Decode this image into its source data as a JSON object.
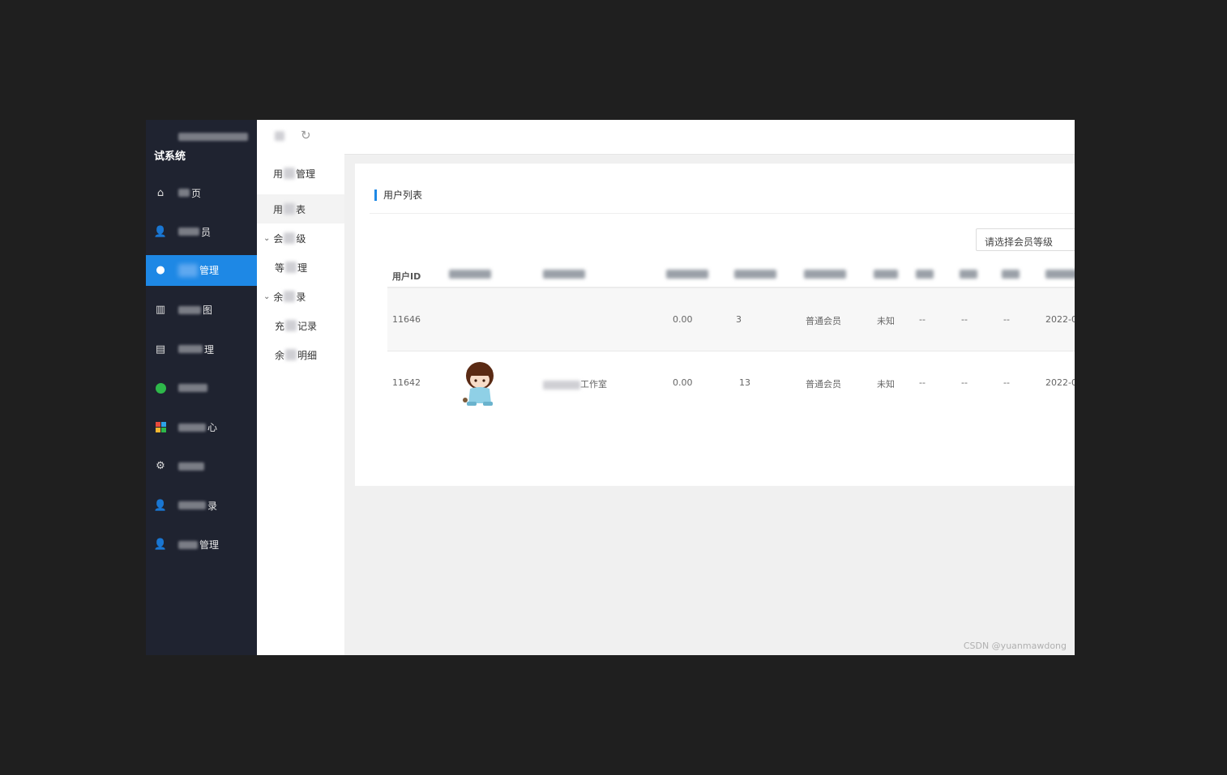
{
  "sidebar": {
    "logo_text": "试系统",
    "items": [
      {
        "icon": "home-icon",
        "label": "页",
        "active": false
      },
      {
        "icon": "user-settings-icon",
        "label": "员",
        "active": false
      },
      {
        "icon": "user-icon",
        "label": "管理",
        "active": true
      },
      {
        "icon": "library-icon",
        "label": "图",
        "active": false
      },
      {
        "icon": "document-icon",
        "label": "理",
        "active": false
      },
      {
        "icon": "music-icon",
        "label": "",
        "active": false
      },
      {
        "icon": "apps-icon",
        "label": "心",
        "active": false
      },
      {
        "icon": "gear-icon",
        "label": "",
        "active": false
      },
      {
        "icon": "user-settings-icon",
        "label": "录",
        "active": false
      },
      {
        "icon": "user-settings-icon",
        "label": "管理",
        "active": false
      }
    ]
  },
  "subnav": {
    "items": [
      {
        "type": "header",
        "pre": "用",
        "post": "管理"
      },
      {
        "type": "item",
        "pre": "用",
        "post": "表",
        "active": true
      },
      {
        "type": "group",
        "pre": "会",
        "post": "级"
      },
      {
        "type": "child",
        "pre": "等",
        "post": "理"
      },
      {
        "type": "group",
        "pre": "余",
        "post": "录"
      },
      {
        "type": "child",
        "pre": "充",
        "post": "记录"
      },
      {
        "type": "child",
        "pre": "余",
        "post": "明细"
      }
    ]
  },
  "header": {
    "refresh_icon": "refresh-icon"
  },
  "card": {
    "title": "用户列表",
    "select_placeholder": "请选择会员等级"
  },
  "table": {
    "headers": [
      "用户ID",
      "",
      "",
      "",
      "",
      "",
      "",
      "",
      "",
      "",
      ""
    ],
    "rows": [
      {
        "id": "11646",
        "name": "",
        "balance": "0.00",
        "count": "3",
        "level": "普通会员",
        "gender": "未知",
        "c1": "--",
        "c2": "--",
        "c3": "--",
        "date": "2022-0",
        "has_avatar": false
      },
      {
        "id": "11642",
        "name": "工作室",
        "balance": "0.00",
        "count": "13",
        "level": "普通会员",
        "gender": "未知",
        "c1": "--",
        "c2": "--",
        "c3": "--",
        "date": "2022-0",
        "has_avatar": true
      }
    ]
  },
  "watermark": "CSDN @yuanmawdong",
  "colors": {
    "accent": "#1e88e5",
    "sidebar_bg": "#1f2330",
    "page_bg": "#f0f0f0"
  }
}
